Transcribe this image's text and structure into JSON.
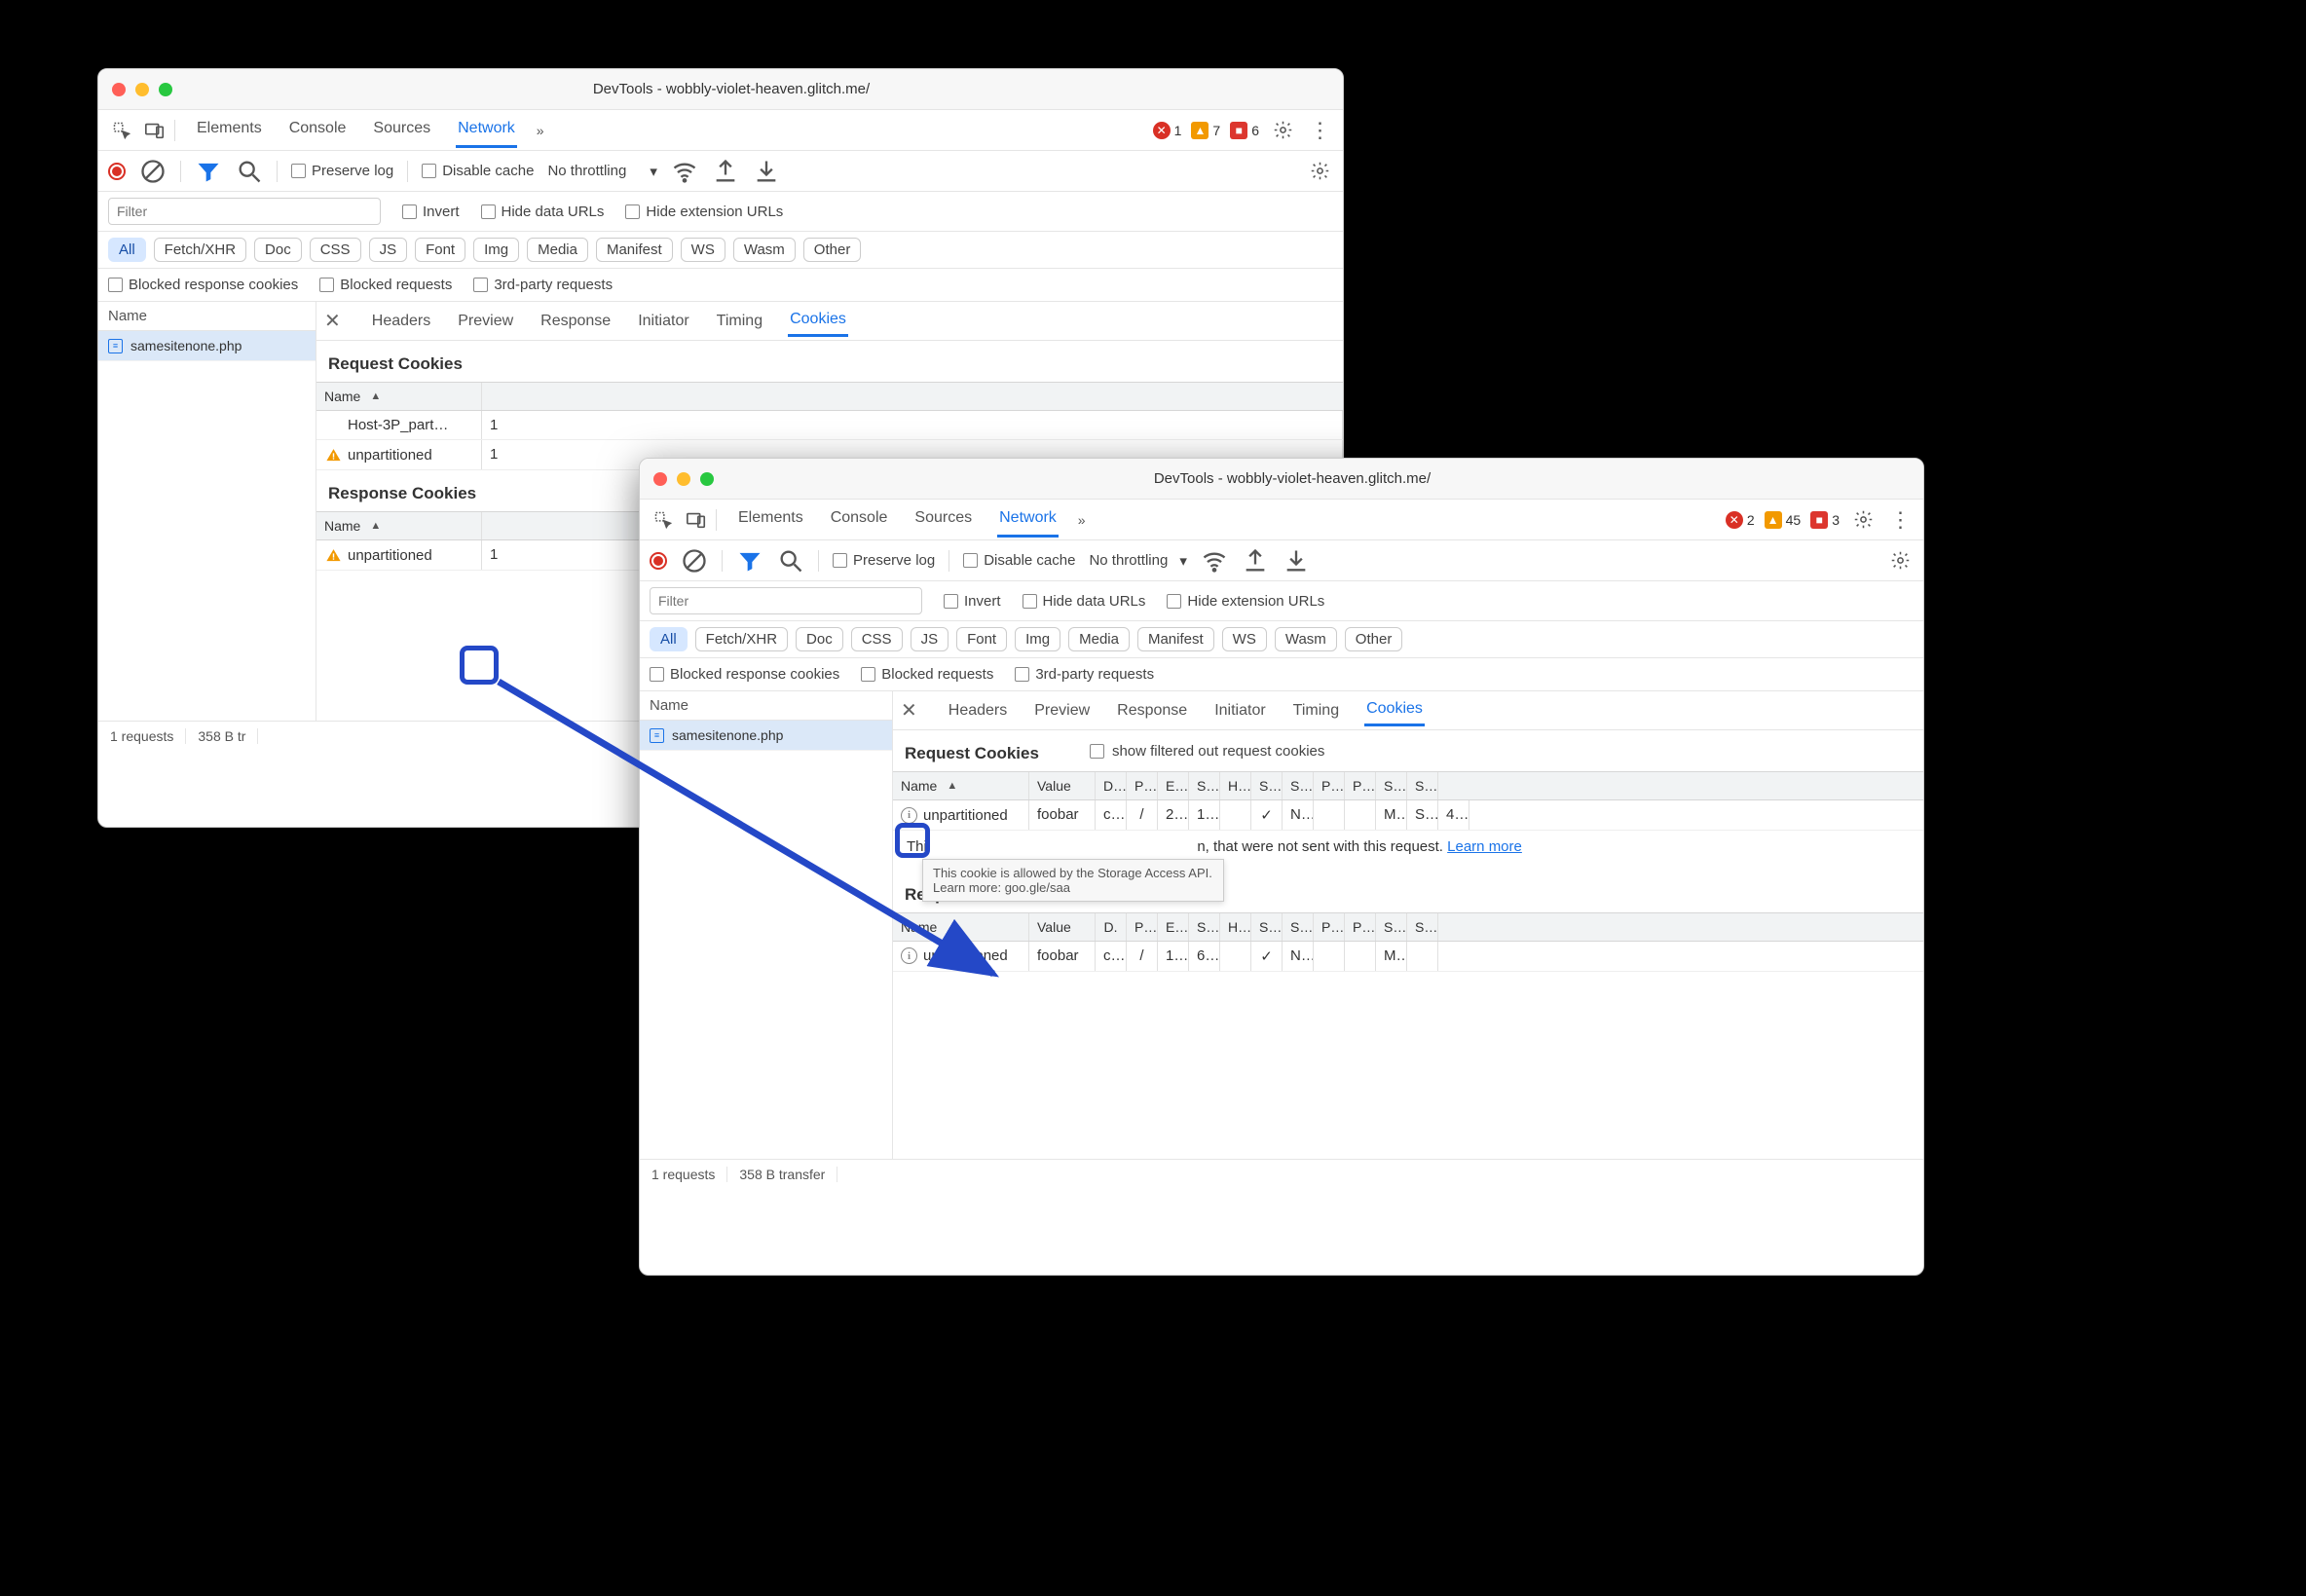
{
  "window1": {
    "title": "DevTools - wobbly-violet-heaven.glitch.me/",
    "tabs": {
      "elements": "Elements",
      "console": "Console",
      "sources": "Sources",
      "network": "Network"
    },
    "badges": {
      "errors": "1",
      "warnings": "7",
      "issues": "6"
    },
    "toolbar2": {
      "preserve_log": "Preserve log",
      "disable_cache": "Disable cache",
      "throttling": "No throttling"
    },
    "filterbar": {
      "filter_placeholder": "Filter",
      "invert": "Invert",
      "hide_data": "Hide data URLs",
      "hide_ext": "Hide extension URLs"
    },
    "chips": [
      "All",
      "Fetch/XHR",
      "Doc",
      "CSS",
      "JS",
      "Font",
      "Img",
      "Media",
      "Manifest",
      "WS",
      "Wasm",
      "Other"
    ],
    "checks": {
      "blocked_cookies": "Blocked response cookies",
      "blocked_requests": "Blocked requests",
      "third_party": "3rd-party requests"
    },
    "sidebar": {
      "name_header": "Name",
      "items": [
        "samesitenone.php"
      ]
    },
    "status": {
      "requests": "1 requests",
      "transfer": "358 B tr"
    },
    "subtabs": {
      "headers": "Headers",
      "preview": "Preview",
      "response": "Response",
      "initiator": "Initiator",
      "timing": "Timing",
      "cookies": "Cookies"
    },
    "request_cookies": {
      "title": "Request Cookies",
      "header_name": "Name",
      "rows": [
        {
          "icon": "none",
          "name": "Host-3P_part…"
        },
        {
          "icon": "warn",
          "name": "unpartitioned"
        }
      ]
    },
    "response_cookies": {
      "title": "Response Cookies",
      "header_name": "Name",
      "rows": [
        {
          "icon": "warn",
          "name": "unpartitioned"
        }
      ]
    }
  },
  "window2": {
    "title": "DevTools - wobbly-violet-heaven.glitch.me/",
    "tabs": {
      "elements": "Elements",
      "console": "Console",
      "sources": "Sources",
      "network": "Network"
    },
    "badges": {
      "errors": "2",
      "warnings": "45",
      "issues": "3"
    },
    "toolbar2": {
      "preserve_log": "Preserve log",
      "disable_cache": "Disable cache",
      "throttling": "No throttling"
    },
    "filterbar": {
      "filter_placeholder": "Filter",
      "invert": "Invert",
      "hide_data": "Hide data URLs",
      "hide_ext": "Hide extension URLs"
    },
    "chips": [
      "All",
      "Fetch/XHR",
      "Doc",
      "CSS",
      "JS",
      "Font",
      "Img",
      "Media",
      "Manifest",
      "WS",
      "Wasm",
      "Other"
    ],
    "checks": {
      "blocked_cookies": "Blocked response cookies",
      "blocked_requests": "Blocked requests",
      "third_party": "3rd-party requests"
    },
    "sidebar": {
      "name_header": "Name",
      "items": [
        "samesitenone.php"
      ]
    },
    "status": {
      "requests": "1 requests",
      "transfer": "358 B transfer"
    },
    "subtabs": {
      "headers": "Headers",
      "preview": "Preview",
      "response": "Response",
      "initiator": "Initiator",
      "timing": "Timing",
      "cookies": "Cookies"
    },
    "request_cookies": {
      "title": "Request Cookies",
      "show": "show filtered out request cookies",
      "headers": [
        "Name",
        "Value",
        "D…",
        "P…",
        "E…",
        "S…",
        "H…",
        "S…",
        "S…",
        "P…",
        "P…",
        "S…",
        "S…"
      ],
      "rows": [
        {
          "icon": "info",
          "cells": [
            "unpartitioned",
            "foobar",
            "c…",
            "/",
            "2…",
            "1…",
            "",
            "✓",
            "N…",
            "",
            "",
            "M…",
            "S…",
            "4…"
          ]
        }
      ],
      "tooltip": "This cookie is allowed by the Storage Access API. Learn more: goo.gle/saa",
      "note_prefix": "Thi",
      "note_suffix": "n, that were not sent with this request. ",
      "learn_more": "Learn more"
    },
    "response_cookies": {
      "title": "Response Cookies",
      "headers": [
        "Name",
        "Value",
        "D.",
        "P…",
        "E…",
        "S…",
        "H…",
        "S…",
        "S…",
        "P…",
        "P…",
        "S…",
        "S…"
      ],
      "rows": [
        {
          "icon": "info",
          "cells": [
            "unpartitioned",
            "foobar",
            "c…",
            "/",
            "1…",
            "6…",
            "",
            "✓",
            "N…",
            "",
            "",
            "M…",
            ""
          ]
        }
      ]
    }
  }
}
